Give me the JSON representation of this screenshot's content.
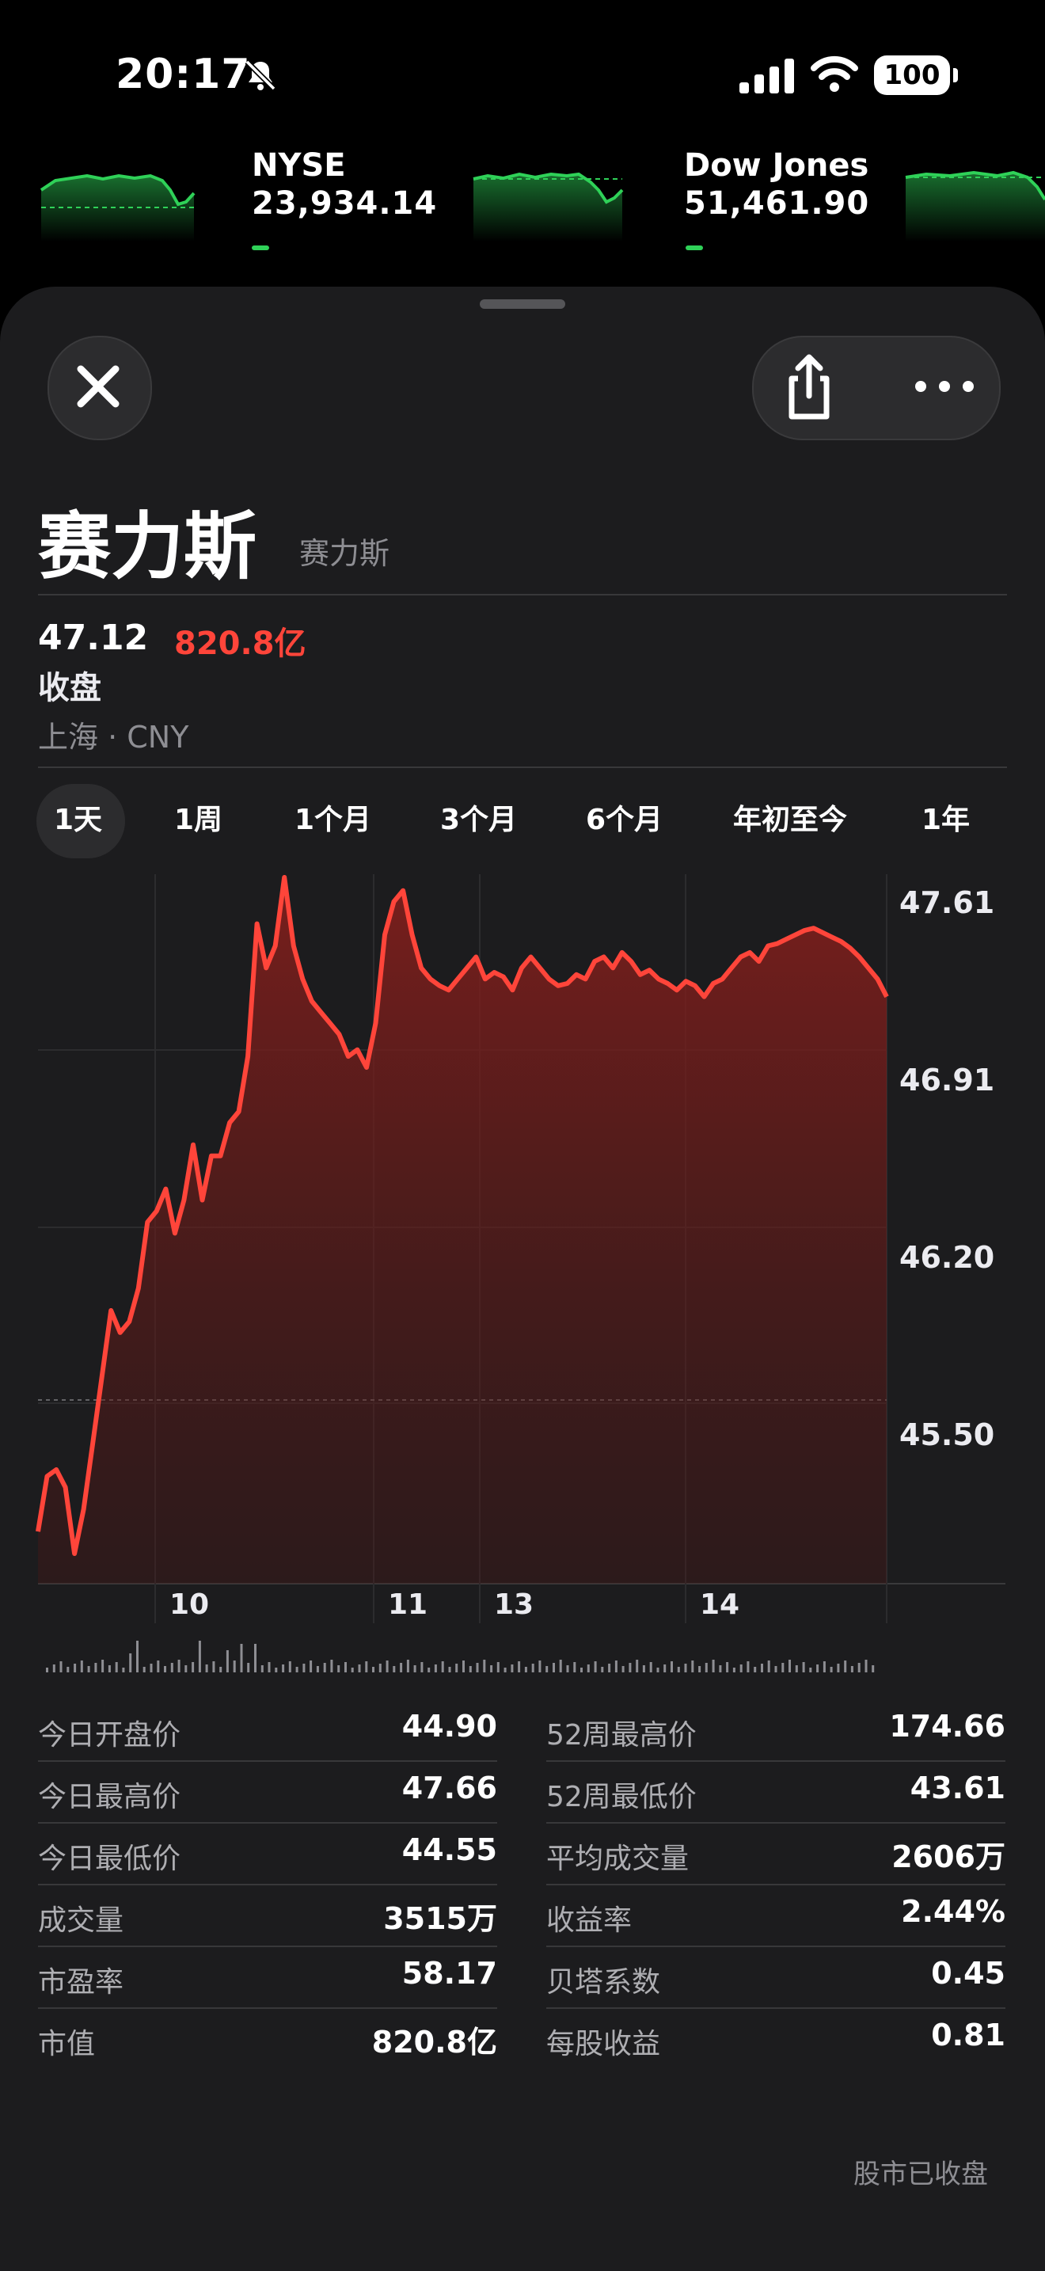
{
  "status_bar": {
    "time": "20:17",
    "battery": "100"
  },
  "ticker": [
    {
      "name": "NYSE",
      "value": "23,934.14"
    },
    {
      "name": "Dow Jones",
      "value": "51,461.90"
    }
  ],
  "stock": {
    "title": "赛力斯",
    "subtitle": "赛力斯",
    "price": "47.12",
    "market_cap": "820.8亿",
    "status": "收盘",
    "exchange": "上海 · CNY"
  },
  "tabs": [
    "1天",
    "1周",
    "1个月",
    "3个月",
    "6个月",
    "年初至今",
    "1年"
  ],
  "chart_data": {
    "type": "area",
    "x_tick_labels": [
      "10",
      "11",
      "13",
      "14"
    ],
    "y_tick_labels": [
      "47.61",
      "46.91",
      "46.20",
      "45.50"
    ],
    "ylim": [
      44.55,
      47.66
    ],
    "color": "#ff453a",
    "values": [
      44.7,
      44.95,
      44.98,
      44.9,
      44.6,
      44.8,
      45.1,
      45.4,
      45.7,
      45.6,
      45.65,
      45.8,
      46.1,
      46.15,
      46.25,
      46.05,
      46.2,
      46.45,
      46.2,
      46.4,
      46.4,
      46.55,
      46.6,
      46.85,
      47.45,
      47.25,
      47.35,
      47.66,
      47.35,
      47.2,
      47.1,
      47.05,
      47.0,
      46.95,
      46.85,
      46.88,
      46.8,
      47.0,
      47.4,
      47.55,
      47.6,
      47.4,
      47.25,
      47.2,
      47.17,
      47.15,
      47.2,
      47.25,
      47.3,
      47.2,
      47.23,
      47.21,
      47.15,
      47.25,
      47.3,
      47.25,
      47.2,
      47.17,
      47.18,
      47.22,
      47.2,
      47.28,
      47.3,
      47.25,
      47.32,
      47.28,
      47.22,
      47.24,
      47.2,
      47.18,
      47.15,
      47.19,
      47.17,
      47.12,
      47.18,
      47.2,
      47.25,
      47.3,
      47.32,
      47.28,
      47.35,
      47.36,
      47.38,
      47.4,
      47.42,
      47.43,
      47.41,
      47.39,
      47.37,
      47.34,
      47.3,
      47.25,
      47.2,
      47.12
    ]
  },
  "stats_left": [
    {
      "label": "今日开盘价",
      "value": "44.90"
    },
    {
      "label": "今日最高价",
      "value": "47.66"
    },
    {
      "label": "今日最低价",
      "value": "44.55"
    },
    {
      "label": "成交量",
      "value": "3515万"
    },
    {
      "label": "市盈率",
      "value": "58.17"
    },
    {
      "label": "市值",
      "value": "820.8亿"
    }
  ],
  "stats_right": [
    {
      "label": "52周最高价",
      "value": "174.66"
    },
    {
      "label": "52周最低价",
      "value": "43.61"
    },
    {
      "label": "平均成交量",
      "value": "2606万"
    },
    {
      "label": "收益率",
      "value": "2.44%"
    },
    {
      "label": "贝塔系数",
      "value": "0.45"
    },
    {
      "label": "每股收益",
      "value": "0.81"
    }
  ],
  "footer": "股市已收盘"
}
